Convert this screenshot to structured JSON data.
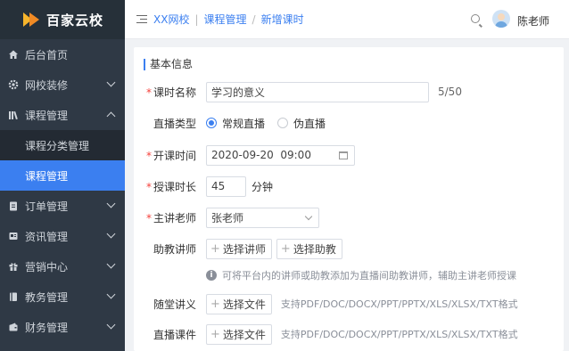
{
  "brand": {
    "name": "百家云校"
  },
  "sidebar": {
    "items": [
      {
        "label": "后台首页",
        "icon": "home-icon"
      },
      {
        "label": "网校装修",
        "icon": "gear-icon"
      },
      {
        "label": "课程管理",
        "icon": "books-icon",
        "expanded": true
      },
      {
        "label": "课程分类管理",
        "sub": true
      },
      {
        "label": "课程管理",
        "sub": true,
        "active": true
      },
      {
        "label": "订单管理",
        "icon": "clipboard-icon"
      },
      {
        "label": "资讯管理",
        "icon": "news-icon"
      },
      {
        "label": "营销中心",
        "icon": "gift-icon"
      },
      {
        "label": "教务管理",
        "icon": "book-icon"
      },
      {
        "label": "财务管理",
        "icon": "wallet-icon"
      }
    ]
  },
  "header": {
    "breadcrumb": [
      "XX网校",
      "课程管理",
      "新增课时"
    ],
    "user_name": "陈老师"
  },
  "form": {
    "section_title": "基本信息",
    "lesson_name": {
      "label": "课时名称",
      "value": "学习的意义",
      "counter": "5/50"
    },
    "live_type": {
      "label": "直播类型",
      "options": [
        "常规直播",
        "伪直播"
      ],
      "selected": "常规直播"
    },
    "start_time": {
      "label": "开课时间",
      "value": "2020-09-20  09:00"
    },
    "duration": {
      "label": "授课时长",
      "value": "45",
      "unit": "分钟"
    },
    "teacher": {
      "label": "主讲老师",
      "value": "张老师"
    },
    "assistant": {
      "label": "助教讲师",
      "btn_teacher": "选择讲师",
      "btn_assistant": "选择助教",
      "hint": "可将平台内的讲师或助教添加为直播间助教讲师，辅助主讲老师授课"
    },
    "handout": {
      "label": "随堂讲义",
      "btn": "选择文件",
      "formats": "支持PDF/DOC/DOCX/PPT/PPTX/XLS/XLSX/TXT格式"
    },
    "courseware": {
      "label": "直播课件",
      "btn": "选择文件",
      "formats": "支持PDF/DOC/DOCX/PPT/PPTX/XLS/XLSX/TXT格式"
    }
  },
  "colors": {
    "accent": "#3b7ff0",
    "required": "#f5413b",
    "sidebar": "#2f3945"
  }
}
